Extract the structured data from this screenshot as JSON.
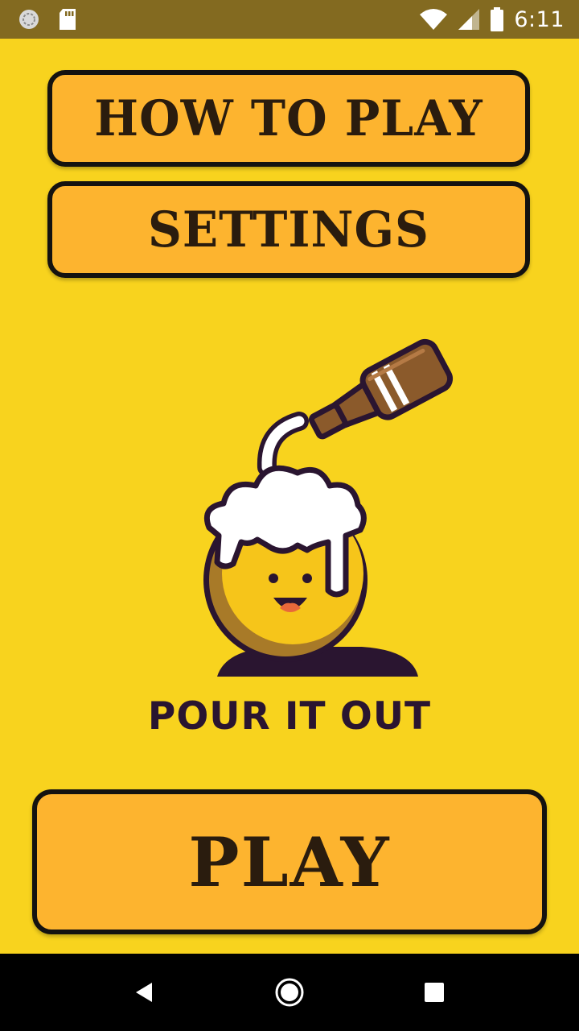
{
  "status_bar": {
    "time": "6:11",
    "left_icons": [
      "sync-icon",
      "sd-card-icon"
    ],
    "right_icons": [
      "wifi-icon",
      "signal-icon",
      "battery-icon"
    ]
  },
  "menu": {
    "how_to_play_label": "HOW TO PLAY",
    "settings_label": "SETTINGS"
  },
  "logo": {
    "title": "POUR IT OUT"
  },
  "play": {
    "label": "PLAY"
  },
  "nav_bar": {
    "icons": [
      "back-icon",
      "home-icon",
      "recent-apps-icon"
    ]
  },
  "colors": {
    "background": "#F8D31E",
    "status_bar": "#836A20",
    "button_fill": "#FDB42F",
    "button_border": "#141210",
    "title_text": "#2A1530"
  }
}
